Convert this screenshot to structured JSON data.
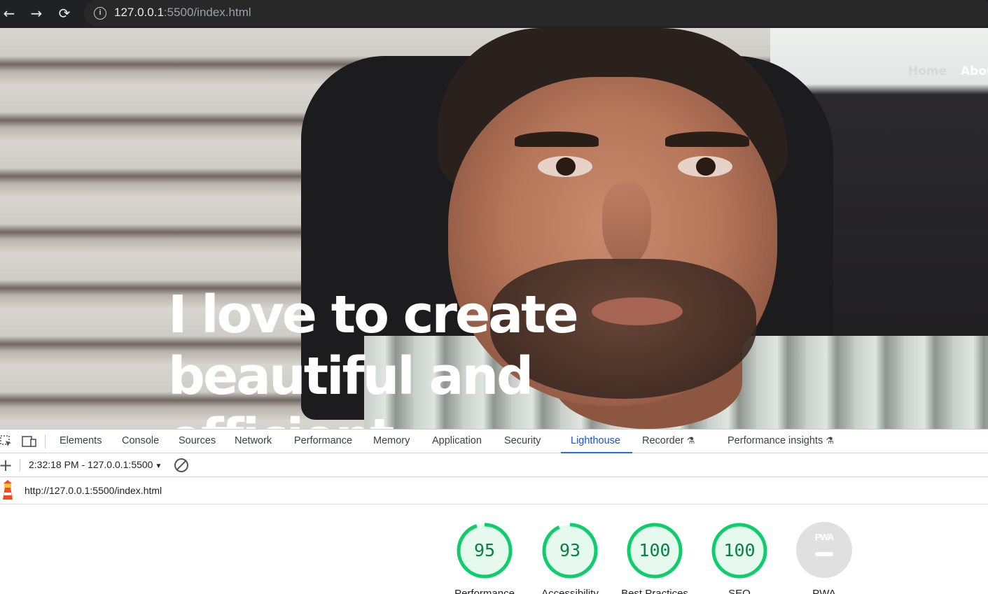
{
  "browser": {
    "url_host": "127.0.0.1",
    "url_rest": ":5500/index.html",
    "back_icon": "←",
    "forward_icon": "→",
    "reload_icon": "⟳",
    "info_icon": "i"
  },
  "site": {
    "nav": [
      "Home",
      "Abou"
    ],
    "hero_line1": "I love to create",
    "hero_line2": "beautiful and",
    "hero_line3": "efficient websites"
  },
  "devtools": {
    "tabs": [
      "Elements",
      "Console",
      "Sources",
      "Network",
      "Performance",
      "Memory",
      "Application",
      "Security",
      "Lighthouse",
      "Recorder",
      "Performance insights"
    ],
    "active_tab": "Lighthouse",
    "report_select": "2:32:18 PM - 127.0.0.1:5500",
    "report_url": "http://127.0.0.1:5500/index.html",
    "pwa_badge": "PWA",
    "scores": [
      {
        "category": "Performance",
        "score": 95
      },
      {
        "category": "Accessibility",
        "score": 93
      },
      {
        "category": "Best Practices",
        "score": 100
      },
      {
        "category": "SEO",
        "score": 100
      }
    ],
    "pwa_label": "PWA",
    "colors": {
      "pass": "#0cce6b",
      "pass_text": "#0b8043",
      "pass_bg": "#e6f9ee",
      "active_tab": "#1a73e8"
    }
  }
}
